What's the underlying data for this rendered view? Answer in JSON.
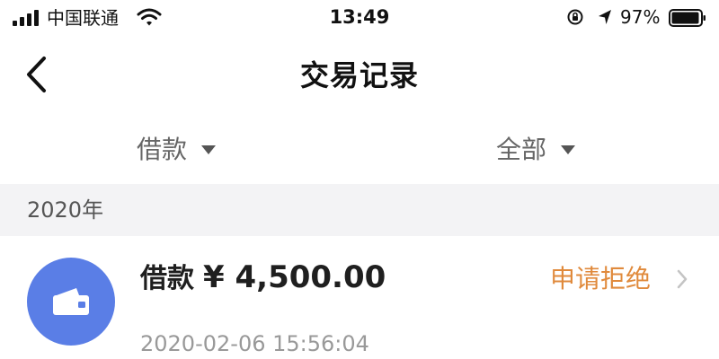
{
  "status_bar": {
    "carrier": "中国联通",
    "time": "13:49",
    "battery_percent": "97%"
  },
  "nav": {
    "title": "交易记录"
  },
  "filters": {
    "type_label": "借款",
    "status_label": "全部"
  },
  "sections": [
    {
      "title": "2020年",
      "transactions": [
        {
          "type": "借款",
          "amount": "¥ 4,500.00",
          "status": "申请拒绝",
          "time": "2020-02-06 15:56:04"
        }
      ]
    }
  ],
  "colors": {
    "accent_blue": "#5a7ee6",
    "status_orange": "#e08a3c",
    "section_bg": "#f3f3f5"
  },
  "icons": {
    "back": "chevron-left-icon",
    "dropdown": "caret-down-icon",
    "transaction": "wallet-icon",
    "row_arrow": "chevron-right-icon"
  }
}
